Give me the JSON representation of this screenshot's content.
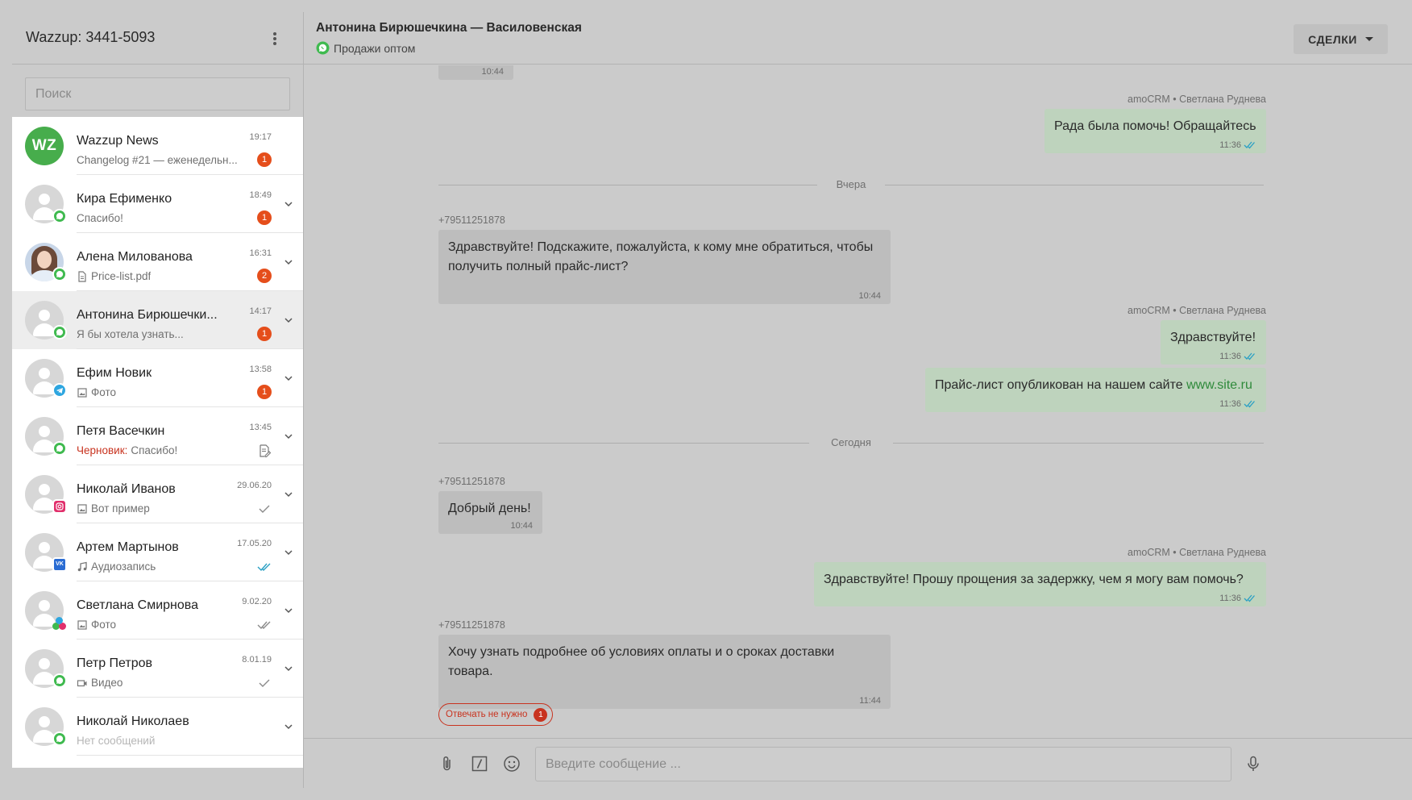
{
  "sidebar": {
    "title": "Wazzup: 3441-5093",
    "search_placeholder": "Поиск",
    "chats": [
      {
        "name": "Wazzup News",
        "preview": "Changelog #21 — еженедельн...",
        "time": "19:17",
        "unread": "1",
        "avatar": "WZ",
        "channel": "none",
        "preview_icon": "none",
        "status": "unread"
      },
      {
        "name": "Кира Ефименко",
        "preview": "Спасибо!",
        "time": "18:49",
        "unread": "1",
        "channel": "whatsapp",
        "preview_icon": "none",
        "status": "unread"
      },
      {
        "name": "Алена Милованова",
        "preview": "Price-list.pdf",
        "time": "16:31",
        "unread": "2",
        "channel": "whatsapp",
        "preview_icon": "document-icon",
        "status": "unread"
      },
      {
        "name": "Антонина Бирюшечки...",
        "preview": "Я бы хотела узнать...",
        "time": "14:17",
        "unread": "1",
        "channel": "whatsapp",
        "preview_icon": "none",
        "status": "unread",
        "selected": true
      },
      {
        "name": "Ефим Новик",
        "preview": "Фото",
        "time": "13:58",
        "unread": "1",
        "channel": "telegram",
        "preview_icon": "image-icon",
        "status": "unread"
      },
      {
        "name": "Петя Васечкин",
        "draft_label": "Черновик:",
        "preview": "Спасибо!",
        "time": "13:45",
        "channel": "whatsapp",
        "preview_icon": "none",
        "status": "draft"
      },
      {
        "name": "Николай Иванов",
        "preview": "Вот пример",
        "time": "29.06.20",
        "channel": "instagram",
        "preview_icon": "image-icon",
        "status": "sent"
      },
      {
        "name": "Артем Мартынов",
        "preview": "Аудиозапись",
        "time": "17.05.20",
        "channel": "vk",
        "preview_icon": "music-icon",
        "status": "read"
      },
      {
        "name": "Светлана Смирнова",
        "preview": "Фото",
        "time": "9.02.20",
        "channel": "multi",
        "preview_icon": "image-icon",
        "status": "delivered"
      },
      {
        "name": "Петр Петров",
        "preview": "Видео",
        "time": "8.01.19",
        "channel": "whatsapp",
        "preview_icon": "video-icon",
        "status": "sent"
      },
      {
        "name": "Николай Николаев",
        "preview": "Нет сообщений",
        "time": "",
        "channel": "whatsapp",
        "preview_icon": "none",
        "status": "none"
      }
    ]
  },
  "chat": {
    "title": "Антонина Бирюшечкина — Василовенская",
    "subtitle": "Продажи оптом",
    "deals_button": "СДЕЛКИ",
    "partial_time": "10:44",
    "senders": {
      "agent": "amoCRM • Светлана Руднева",
      "client": "+79511251878"
    },
    "dates": {
      "yesterday": "Вчера",
      "today": "Сегодня"
    },
    "messages": [
      {
        "text": "Рада была помочь! Обращайтесь",
        "time": "11:36"
      },
      {
        "text": "Здравствуйте! Подскажите, пожалуйста, к кому мне обратиться, чтобы получить полный прайс-лист?",
        "time": "10:44"
      },
      {
        "text": "Здравствуйте!",
        "time": "11:36"
      },
      {
        "text": "Прайс-лист опубликован на нашем сайте ",
        "link": "www.site.ru",
        "time": "11:36"
      },
      {
        "text": "Добрый день!",
        "time": "10:44"
      },
      {
        "text": "Здравствуйте! Прошу прощения за задержку, чем я могу вам помочь?",
        "time": "11:36"
      },
      {
        "text": "Хочу узнать подробнее об условиях оплаты и о сроках доставки товара.",
        "time": "11:44"
      }
    ],
    "no_reply_label": "Отвечать не нужно",
    "no_reply_count": "1"
  },
  "composer": {
    "placeholder": "Введите сообщение ..."
  },
  "colors": {
    "unread_badge": "#e54e1b",
    "whatsapp": "#3fba4f",
    "telegram": "#2ea6e0",
    "read_ticks": "#2aa0c4",
    "outgoing_bubble": "#bed3bd",
    "incoming_bubble": "#bdbdbd"
  }
}
